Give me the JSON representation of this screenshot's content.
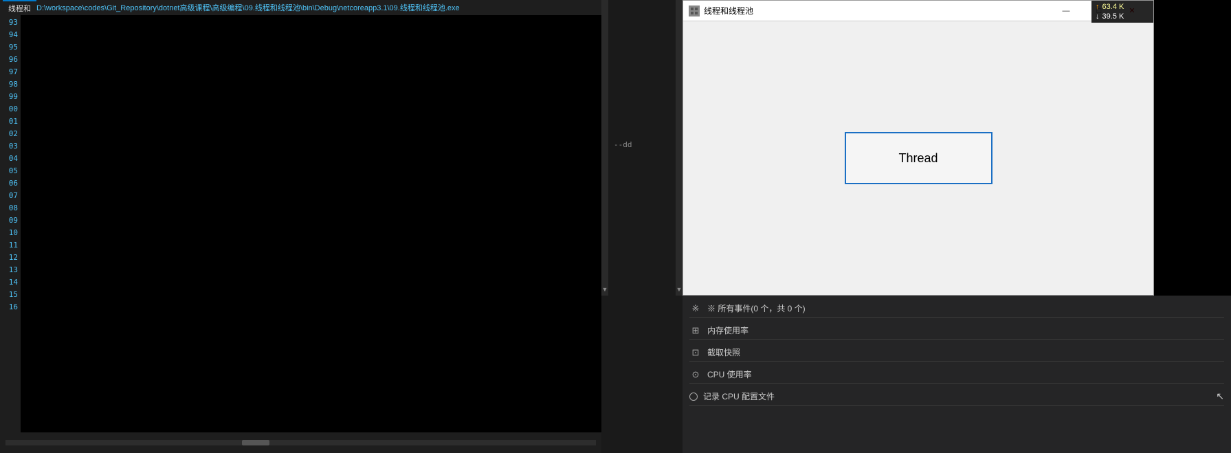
{
  "terminal": {
    "tab_label": "线程和",
    "path": "D:\\workspace\\codes\\Git_Repository\\dotnet高级课程\\高级编程\\09.线程和线程池\\bin\\Debug\\netcoreapp3.1\\09.线程和线程池.exe",
    "line_numbers": [
      "93",
      "94",
      "95",
      "96",
      "97",
      "98",
      "99",
      "00",
      "01",
      "02",
      "03",
      "04",
      "05",
      "06",
      "07",
      "08",
      "09",
      "10",
      "11",
      "12",
      "13",
      "14",
      "15",
      "16"
    ]
  },
  "winforms": {
    "title": "线程和线程池",
    "icon_label": "app-icon",
    "minimize_label": "—",
    "maximize_label": "□",
    "close_label": "✕",
    "thread_button_label": "Thread"
  },
  "network": {
    "upload_label": "↑ 63.4 K",
    "download_label": "↓ 39.5 K"
  },
  "diagnostics": {
    "events_label": "※ 所有事件(0 个，共 0 个)",
    "memory_label": "内存使用率",
    "memory_icon": "⊞",
    "screenshot_label": "截取快照",
    "screenshot_icon": "⊡",
    "cpu_label": "CPU 使用率",
    "cpu_radio_label": "记录 CPU 配置文件"
  },
  "mid_panel": {
    "dd_text": "--dd"
  },
  "scrollbar": {
    "down_arrow": "▼"
  }
}
